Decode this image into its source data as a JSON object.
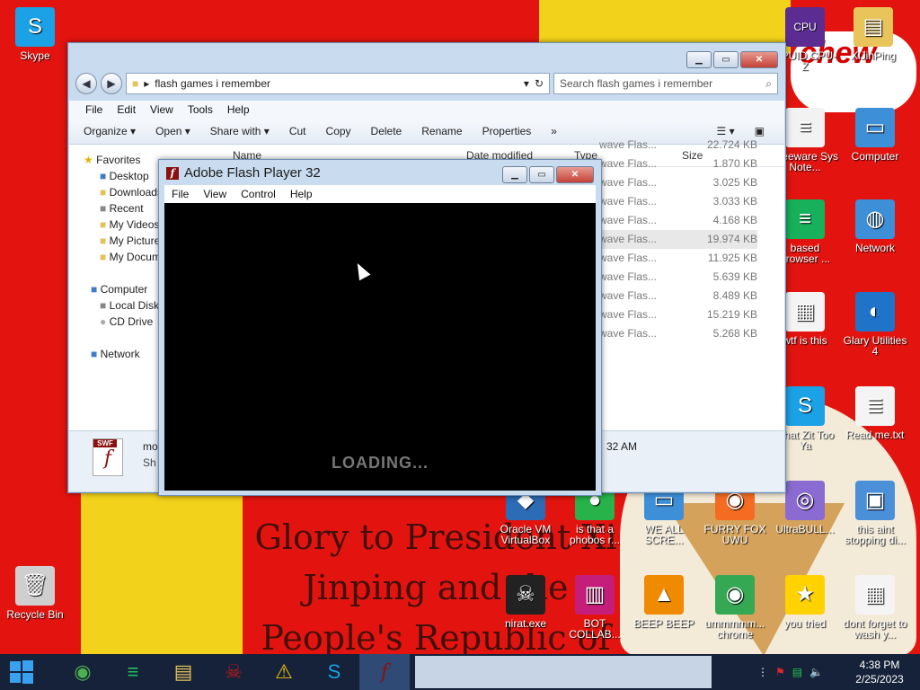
{
  "desktop": {
    "wallpaper_text": "Glory to President Xi Jinping and the People's Republic of China",
    "wallpaper_badge": "chew",
    "icons": [
      {
        "label": "Skype",
        "icon": "skype-icon",
        "color": "#1aa1e6"
      },
      {
        "label": "Recycle Bin",
        "icon": "recycle-bin-icon",
        "color": "#cfcfcf"
      },
      {
        "label": "CPUID CPU-Z",
        "icon": "cpu-z-icon",
        "color": "#5b2c91"
      },
      {
        "label": "XiJinPing",
        "icon": "folder-icon",
        "color": "#e9c45a"
      },
      {
        "label": "Freeware Sys Note...",
        "icon": "document-icon",
        "color": "#f2f2f2"
      },
      {
        "label": "Computer",
        "icon": "computer-icon",
        "color": "#3d8fd8"
      },
      {
        "label": "based browser ...",
        "icon": "browser-icon",
        "color": "#16b15a"
      },
      {
        "label": "Network",
        "icon": "network-icon",
        "color": "#3d8fd8"
      },
      {
        "label": "wtf is this",
        "icon": "calendar-doc-icon",
        "color": "#f4f4f4"
      },
      {
        "label": "Glary Utilities 4",
        "icon": "glary-icon",
        "color": "#1f73c9"
      },
      {
        "label": "what Zit Too Ya",
        "icon": "skype-icon",
        "color": "#1aa1e6"
      },
      {
        "label": "Read me.txt",
        "icon": "text-file-icon",
        "color": "#f4f4f4"
      },
      {
        "label": "Oracle VM VirtualBox",
        "icon": "virtualbox-icon",
        "color": "#2c6bb5"
      },
      {
        "label": "is that a phobos r...",
        "icon": "phobos-icon",
        "color": "#28b34a"
      },
      {
        "label": "WE ALL SCRE...",
        "icon": "computer-icon",
        "color": "#3d8fd8"
      },
      {
        "label": "FURRY FOX UWU",
        "icon": "firefox-icon",
        "color": "#f46b21"
      },
      {
        "label": "UltraBULL...",
        "icon": "disc-icon",
        "color": "#8a6bd1"
      },
      {
        "label": "this aint stopping di...",
        "icon": "installer-icon",
        "color": "#4a90d9"
      },
      {
        "label": "nirat.exe",
        "icon": "skull-icon",
        "color": "#222222"
      },
      {
        "label": "BOT COLLAB...",
        "icon": "bot-icon",
        "color": "#c41e7a"
      },
      {
        "label": "BEEP BEEP",
        "icon": "vlc-icon",
        "color": "#f08a00"
      },
      {
        "label": "ummmmm... chrome",
        "icon": "chrome-icon",
        "color": "#34a853"
      },
      {
        "label": "you tried",
        "icon": "star-icon",
        "color": "#ffd200"
      },
      {
        "label": "dont forget to wash y...",
        "icon": "calendar-doc-icon",
        "color": "#f4f4f4"
      }
    ]
  },
  "explorer": {
    "address": "flash games i remember",
    "search_placeholder": "Search flash games i remember",
    "menu": [
      "File",
      "Edit",
      "View",
      "Tools",
      "Help"
    ],
    "toolbar": [
      "Organize ▾",
      "Open ▾",
      "Share with ▾",
      "Cut",
      "Copy",
      "Delete",
      "Rename",
      "Properties",
      "»"
    ],
    "columns": [
      "Name",
      "Date modified",
      "Type",
      "Size"
    ],
    "nav": {
      "favorites": "Favorites",
      "desktop": "Desktop",
      "downloads": "Downloads",
      "recent": "Recent",
      "videos": "My Videos",
      "pictures": "My Pictures",
      "documents": "My Documents",
      "computer": "Computer",
      "local_disk": "Local Disk",
      "cd_drive": "CD Drive",
      "network": "Network"
    },
    "files": [
      {
        "type": "wave Flas...",
        "size": "22.724 KB"
      },
      {
        "type": "wave Flas...",
        "size": "1.870 KB"
      },
      {
        "type": "wave Flas...",
        "size": "3.025 KB"
      },
      {
        "type": "wave Flas...",
        "size": "3.033 KB"
      },
      {
        "type": "wave Flas...",
        "size": "4.168 KB"
      },
      {
        "type": "wave Flas...",
        "size": "19.974 KB"
      },
      {
        "type": "wave Flas...",
        "size": "11.925 KB"
      },
      {
        "type": "wave Flas...",
        "size": "5.639 KB"
      },
      {
        "type": "wave Flas...",
        "size": "8.489 KB"
      },
      {
        "type": "wave Flas...",
        "size": "15.219 KB"
      },
      {
        "type": "wave Flas...",
        "size": "5.268 KB"
      }
    ],
    "details": {
      "name": "mo",
      "sub": "Sh",
      "time": "32 AM",
      "thumb": "SWF"
    }
  },
  "flash_window": {
    "title": "Adobe Flash Player 32",
    "menu": [
      "File",
      "View",
      "Control",
      "Help"
    ],
    "loading_text": "LOADING..."
  },
  "taskbar": {
    "apps": [
      "chrome-icon",
      "notes-icon",
      "file-explorer-icon",
      "skull-icon",
      "warning-icon",
      "skype-icon",
      "flash-player-icon"
    ],
    "time": "4:38 PM",
    "date": "2/25/2023"
  }
}
